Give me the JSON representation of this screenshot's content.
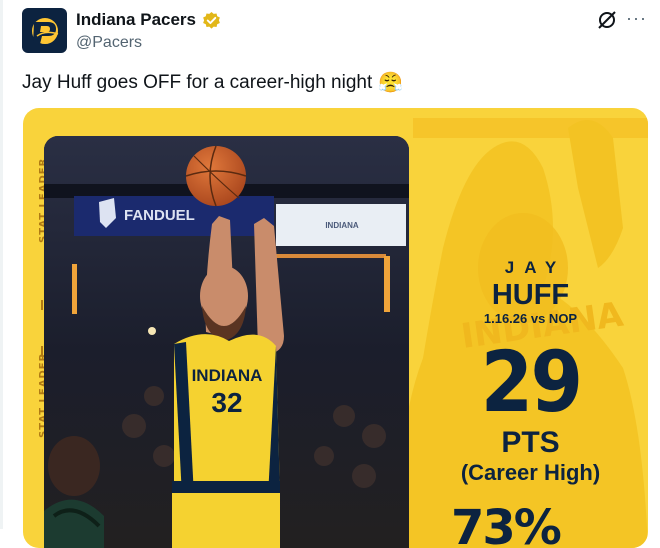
{
  "account": {
    "name": "Indiana Pacers",
    "handle": "@Pacers",
    "verified_badge": "gold-verified-badge-icon",
    "avatar": "pacers-logo-icon"
  },
  "actions": {
    "grok": "grok-icon",
    "more": "···"
  },
  "tweet": {
    "text": "Jay Huff goes OFF for a career-high night",
    "emoji": "😤"
  },
  "graphic": {
    "background_color": "#f9d33b",
    "navy": "#0c2340",
    "side_labels": [
      "STAT LEADER",
      "STAT LEADER"
    ],
    "arena_sign": "FANDUEL",
    "arena_board": "INDIANA",
    "jersey": {
      "team": "INDIANA",
      "number": "32"
    },
    "player_first": "JAY",
    "player_last": "HUFF",
    "game": "1.16.26 vs NOP",
    "stat_value": "29",
    "stat_unit": "PTS",
    "stat_note": "(Career High)",
    "next_stat_partial": "73%"
  }
}
